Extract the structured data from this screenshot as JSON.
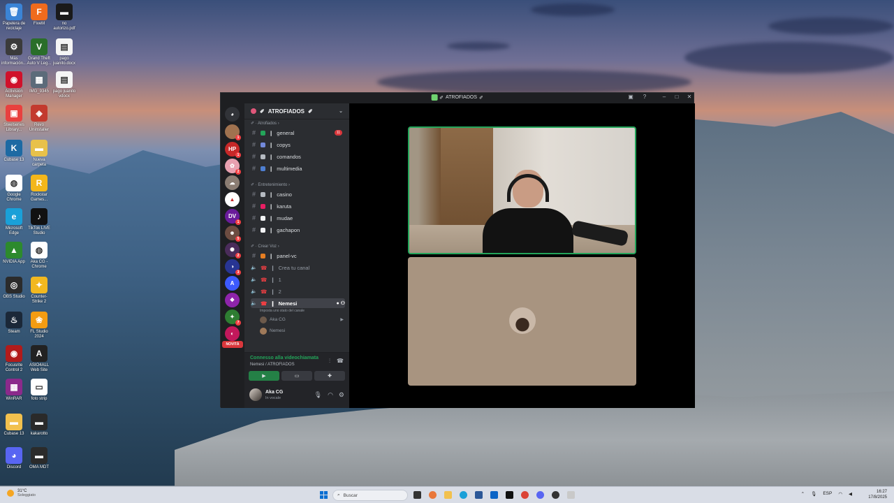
{
  "desktop": {
    "icons": [
      {
        "label": "Papelera de reciclaje",
        "color": "#3b84d6",
        "glyph": "🗑"
      },
      {
        "label": "FiveM",
        "color": "#f06b1d",
        "glyph": "F"
      },
      {
        "label": "no autorizo.pdf",
        "color": "#1a1a1a",
        "glyph": "▬"
      },
      {
        "label": "Más información...",
        "color": "#3b3b3b",
        "glyph": "⚙"
      },
      {
        "label": "Grand Theft Auto V Leg...",
        "color": "#2a6e2a",
        "glyph": "V"
      },
      {
        "label": "pago juanito.docx",
        "color": "#f5f5f5",
        "glyph": "▤"
      },
      {
        "label": "Activision Manager",
        "color": "#d0112b",
        "glyph": "◉"
      },
      {
        "label": "IMG_9345",
        "color": "#5c6b7a",
        "glyph": "▦"
      },
      {
        "label": "pago juanito vdocx",
        "color": "#f5f5f5",
        "glyph": "▤"
      },
      {
        "label": "Steelseries Library...",
        "color": "#e8413f",
        "glyph": "▣"
      },
      {
        "label": "Revo Uninstaller",
        "color": "#c33a2e",
        "glyph": "◈"
      },
      {
        "label": "Cubase 13",
        "color": "#1d6aa3",
        "glyph": "K"
      },
      {
        "label": "Nueva carpeta",
        "color": "#e8c14a",
        "glyph": "▬"
      },
      {
        "label": "Google Chrome",
        "color": "#ffffff",
        "glyph": "◍"
      },
      {
        "label": "Rockstar Games...",
        "color": "#f3b71b",
        "glyph": "R"
      },
      {
        "label": "Microsoft Edge",
        "color": "#1aa0d8",
        "glyph": "e"
      },
      {
        "label": "TikTok LIVE Studio",
        "color": "#111111",
        "glyph": "♪"
      },
      {
        "label": "NVIDIA App",
        "color": "#2d8a2d",
        "glyph": "▲"
      },
      {
        "label": "Aka CG - Chrome",
        "color": "#ffffff",
        "glyph": "◍"
      },
      {
        "label": "OBS Studio",
        "color": "#2b2b2b",
        "glyph": "◎"
      },
      {
        "label": "Counter-Strike 2",
        "color": "#f2b81f",
        "glyph": "✦"
      },
      {
        "label": "Steam",
        "color": "#1b2838",
        "glyph": "♨"
      },
      {
        "label": "FL Studio 2024",
        "color": "#f39c12",
        "glyph": "❀"
      },
      {
        "label": "Focusrite Control 2",
        "color": "#b11b1b",
        "glyph": "◉"
      },
      {
        "label": "ASIO4ALL Web Site",
        "color": "#222222",
        "glyph": "A"
      },
      {
        "label": "WinRAR",
        "color": "#8b2a8b",
        "glyph": "▦"
      },
      {
        "label": "foto strip",
        "color": "#ffffff",
        "glyph": "▭"
      },
      {
        "label": "Cubase 13",
        "color": "#f2c14e",
        "glyph": "▬"
      },
      {
        "label": "kakarotto",
        "color": "#2a2a2a",
        "glyph": "▬"
      },
      {
        "label": "Discord",
        "color": "#5865f2",
        "glyph": "◕"
      },
      {
        "label": "OMA MDT",
        "color": "#2b2b2b",
        "glyph": "▬"
      }
    ]
  },
  "window": {
    "title": "ATROFIADOS",
    "controls": [
      "–",
      "□",
      "✕"
    ]
  },
  "servers": [
    {
      "glyph": "◕",
      "color": "#313338",
      "badge": ""
    },
    {
      "glyph": "",
      "color": "#a0724f",
      "badge": "1"
    },
    {
      "glyph": "HP",
      "color": "#c62828",
      "badge": "1"
    },
    {
      "glyph": "✿",
      "color": "#e8a0b0",
      "badge": "2"
    },
    {
      "glyph": "☁",
      "color": "#8b7d73",
      "badge": ""
    },
    {
      "glyph": "▲",
      "color": "#ffffff",
      "badge": ""
    },
    {
      "glyph": "DV",
      "color": "#6a1b9a",
      "badge": "1"
    },
    {
      "glyph": "☻",
      "color": "#6d4c41",
      "badge": "5"
    },
    {
      "glyph": "✺",
      "color": "#4a2c5a",
      "badge": "2"
    },
    {
      "glyph": "◑",
      "color": "#283593",
      "badge": "3"
    },
    {
      "glyph": "A",
      "color": "#3d5afe",
      "badge": ""
    },
    {
      "glyph": "❖",
      "color": "#8e24aa",
      "badge": ""
    },
    {
      "glyph": "✦",
      "color": "#2e7d32",
      "badge": "7"
    },
    {
      "glyph": "◐",
      "color": "#c2185b",
      "badge": ""
    }
  ],
  "novita_label": "NOVITÀ",
  "sidebar": {
    "server_name": "ATROFIADOS",
    "categories": [
      {
        "label": "Atrofiados"
      },
      {
        "label": "Entretenimiento"
      },
      {
        "label": "Crear Voz"
      }
    ],
    "text_channels": [
      {
        "name": "general",
        "emoji_color": "#23a55a",
        "unread": "11"
      },
      {
        "name": "copys",
        "emoji_color": "#7289da",
        "unread": ""
      },
      {
        "name": "comandos",
        "emoji_color": "#b5bac1",
        "unread": ""
      },
      {
        "name": "multimedia",
        "emoji_color": "#4e7fd1",
        "unread": ""
      },
      {
        "name": "casino",
        "emoji_color": "#b5bac1",
        "unread": ""
      },
      {
        "name": "karuta",
        "emoji_color": "#e91e63",
        "unread": ""
      },
      {
        "name": "mudae",
        "emoji_color": "#f2f3f5",
        "unread": ""
      },
      {
        "name": "gachapon",
        "emoji_color": "#f2f3f5",
        "unread": ""
      },
      {
        "name": "panel-vc",
        "emoji_color": "#e67e22",
        "unread": ""
      }
    ],
    "voice_channels": [
      {
        "name": "Crea tu canal"
      },
      {
        "name": "1"
      },
      {
        "name": "2"
      },
      {
        "name": "Nemesi"
      }
    ],
    "channel_status_placeholder": "Imposta uno stato del canale",
    "members": [
      "Aka CG",
      "Nemesi"
    ]
  },
  "voice_status": {
    "connected": "Connesso alla videochiamata",
    "location": "Nemesi / ATROFIADOS"
  },
  "user": {
    "name": "Aka CG",
    "status": "In vocale"
  },
  "taskbar": {
    "weather_temp": "31°C",
    "weather_desc": "Soleggiato",
    "search_placeholder": "Buscar",
    "lang": "ESP",
    "time": "16:27",
    "date": "17/8/2025"
  }
}
